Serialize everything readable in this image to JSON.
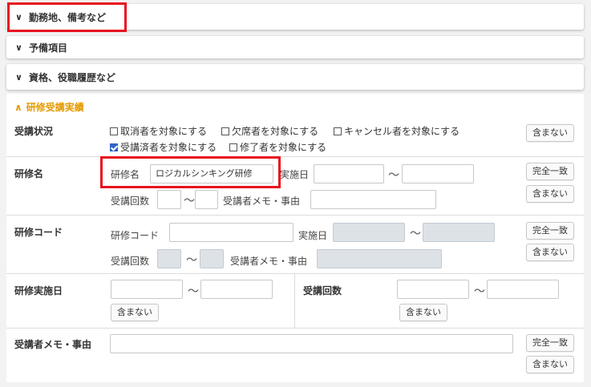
{
  "sections": {
    "workplace": "勤務地、備考など",
    "reserve": "予備項目",
    "qualification": "資格、役職履歴など",
    "training_results": "研修受講実績"
  },
  "status_row": {
    "label": "受講状況",
    "options": [
      {
        "label": "取消者を対象にする",
        "checked": false
      },
      {
        "label": "欠席者を対象にする",
        "checked": false
      },
      {
        "label": "キャンセル者を対象にする",
        "checked": false
      },
      {
        "label": "受講済者を対象にする",
        "checked": true
      },
      {
        "label": "修了者を対象にする",
        "checked": false
      }
    ],
    "exclude_button": "含まない"
  },
  "name_row": {
    "label": "研修名",
    "name_label": "研修名",
    "name_value": "ロジカルシンキング研修",
    "date_label": "実施日",
    "count_label": "受講回数",
    "memo_label": "受講者メモ・事由",
    "exact_button": "完全一致",
    "exclude_button": "含まない"
  },
  "code_row": {
    "label": "研修コード",
    "code_label": "研修コード",
    "date_label": "実施日",
    "count_label": "受講回数",
    "memo_label": "受講者メモ・事由",
    "exact_button": "完全一致",
    "exclude_button": "含まない"
  },
  "date_row": {
    "label": "研修実施日",
    "exclude_button": "含まない",
    "count_label": "受講回数",
    "count_exclude_button": "含まない"
  },
  "memo_row": {
    "label": "受講者メモ・事由",
    "exact_button": "完全一致",
    "exclude_button": "含まない"
  },
  "tilde": "〜",
  "colors": {
    "accent": "#e49b00",
    "highlight": "#e8121e",
    "checkbox": "#2f63c9"
  }
}
